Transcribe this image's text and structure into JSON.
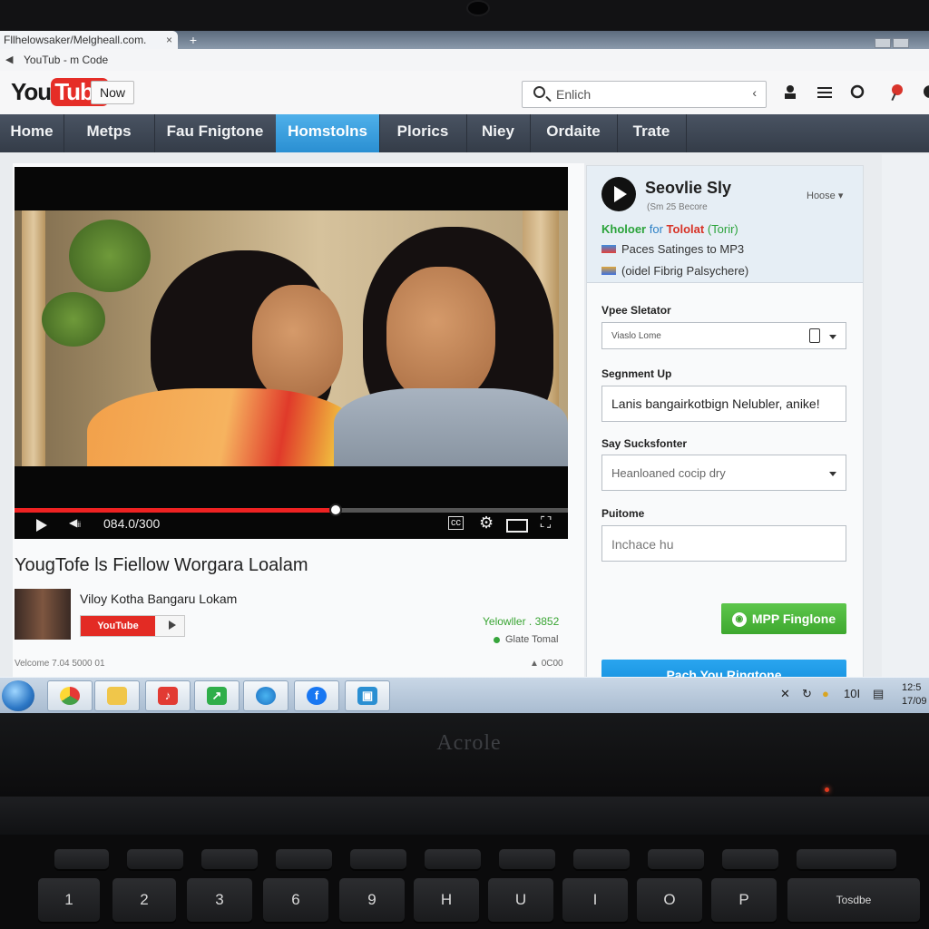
{
  "browser": {
    "tab_title": "Fllhelowsaker/Melgheall.com.",
    "tab_close": "×",
    "new_tab": "+",
    "address": "YouTub - m Code"
  },
  "header": {
    "logo_you": "You",
    "logo_tube": "Tube",
    "now_button": "Now",
    "search_value": "Enlich",
    "search_chevron": "‹"
  },
  "nav": {
    "items": [
      "Home",
      "Metps",
      "Fau Fnigtone",
      "Homstolns",
      "Plorics",
      "Niey",
      "Ordaite",
      "Trate"
    ],
    "active": "Homstolns"
  },
  "player": {
    "time": "084.0/300",
    "progress": 0.58
  },
  "video": {
    "title": "YougTofe ls Fiellow Worgara Loalam",
    "channel": "Viloy Kotha Bangaru Lokam",
    "subscribe_label": "YouTube",
    "views": "Yelowller . 3852",
    "gate": "Glate Tomal",
    "footer_left": "Velcome 7.04   5000 01",
    "footer_right": "0C00"
  },
  "panel": {
    "title": "Seovlie Sly",
    "subtitle": "(Sm 25 Becore",
    "home_label": "Hoose",
    "line1_green": "Kholoer",
    "line1_mid": "for",
    "line1_red": "Tololat",
    "line1_paren": "(Torir)",
    "line2": "Paces Satinges to MP3",
    "line3": "(oidel Fibrig Palsychere)",
    "field1_label": "Vpee Sletator",
    "field1_value": "Viaslo Lome",
    "field2_label": "Segnment Up",
    "field2_value": "Lanis bangairkotbign Nelubler, anike!",
    "field3_label": "Say Sucksfonter",
    "field3_value": "Heanloaned cocip dry",
    "field4_label": "Puitome",
    "field4_placeholder": "Inchace hu",
    "green_button": "MPP Finglone",
    "blue_button": "Pach You Ringtone"
  },
  "taskbar": {
    "tray_text": "10I",
    "clock_time": "12:5",
    "clock_date": "17/09"
  },
  "laptop": {
    "brand": "Acrole",
    "keys": [
      "1",
      "2",
      "3",
      "6",
      "9",
      "H",
      "U",
      "I",
      "O",
      "P",
      "Tosdbe"
    ]
  },
  "colors": {
    "accent_blue": "#2a8fd2",
    "youtube_red": "#e52d27",
    "green": "#3ea82f"
  }
}
